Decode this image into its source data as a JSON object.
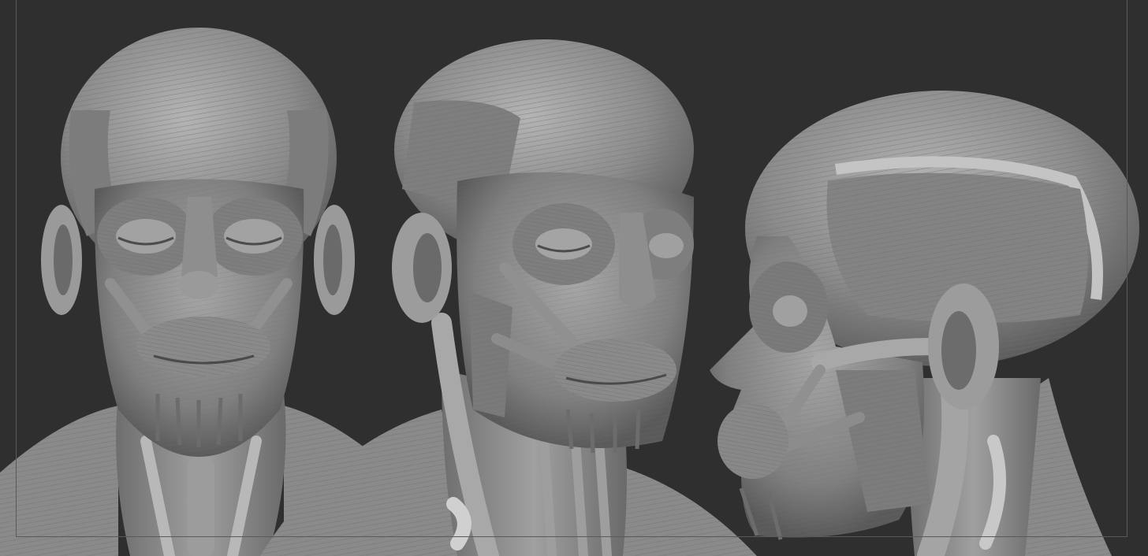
{
  "viewport": {
    "background_color": "#2f2f2f",
    "frame_color": "#5a5a5a"
  },
  "model": {
    "base_color": "#8a8a8a",
    "highlight_color": "#c8c8c8",
    "shadow_color": "#3c3c3c",
    "views": [
      "front",
      "three-quarter",
      "profile"
    ]
  }
}
